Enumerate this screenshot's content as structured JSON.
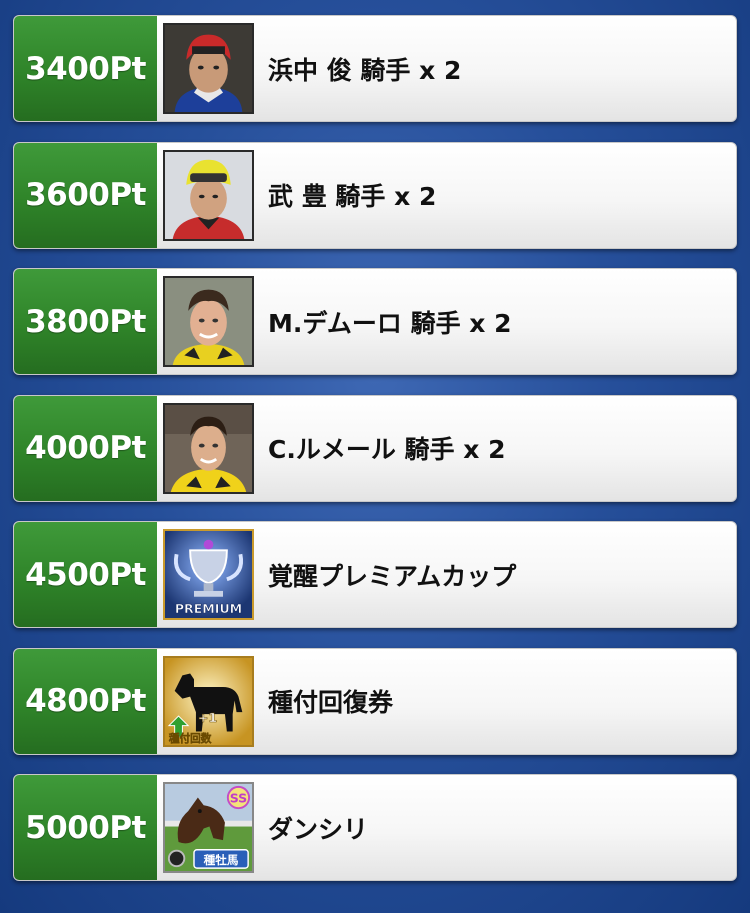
{
  "rewards": [
    {
      "points": "3400Pt",
      "label": "浜中 俊 騎手 x 2",
      "icon": "jockey-portrait-icon"
    },
    {
      "points": "3600Pt",
      "label": "武 豊 騎手 x 2",
      "icon": "jockey-portrait-icon"
    },
    {
      "points": "3800Pt",
      "label": "M.デムーロ 騎手 x 2",
      "icon": "jockey-portrait-icon"
    },
    {
      "points": "4000Pt",
      "label": "C.ルメール 騎手 x 2",
      "icon": "jockey-portrait-icon"
    },
    {
      "points": "4500Pt",
      "label": "覚醒プレミアムカップ",
      "icon": "premium-cup-icon",
      "badge": "PREMIUM"
    },
    {
      "points": "4800Pt",
      "label": "種付回復券",
      "icon": "horse-silhouette-icon",
      "badge": "種付回数",
      "badge_plus": "+1"
    },
    {
      "points": "5000Pt",
      "label": "ダンシリ",
      "icon": "horse-portrait-icon",
      "badge": "種牡馬",
      "rank": "SS"
    }
  ],
  "colors": {
    "points_bg": "#2f8429",
    "background": "#264f9a"
  }
}
